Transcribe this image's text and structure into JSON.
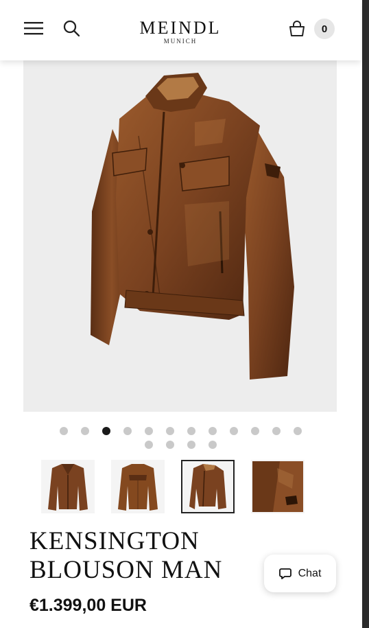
{
  "header": {
    "brand_name": "MEINDL",
    "brand_sub": "MUNICH",
    "cart_count": "0",
    "icons": [
      "menu-icon",
      "search-icon",
      "shopping-bag-icon"
    ]
  },
  "gallery": {
    "dots": [
      false,
      false,
      true,
      false,
      false,
      false,
      false,
      false,
      false,
      false,
      false,
      false,
      false,
      false,
      false,
      false
    ],
    "thumbnails": [
      "jacket-front-open",
      "jacket-back",
      "jacket-three-quarter",
      "jacket-sleeve-detail"
    ],
    "selected_thumbnail": 2
  },
  "product": {
    "title": "KENSINGTON BLOUSON MAN",
    "price": "€1.399,00 EUR"
  },
  "chat": {
    "label": "Chat",
    "icon": "chat-bubble-icon"
  },
  "colors": {
    "leather": "#7a4220",
    "leather_dark": "#4e2610",
    "image_bg": "#ededed"
  }
}
